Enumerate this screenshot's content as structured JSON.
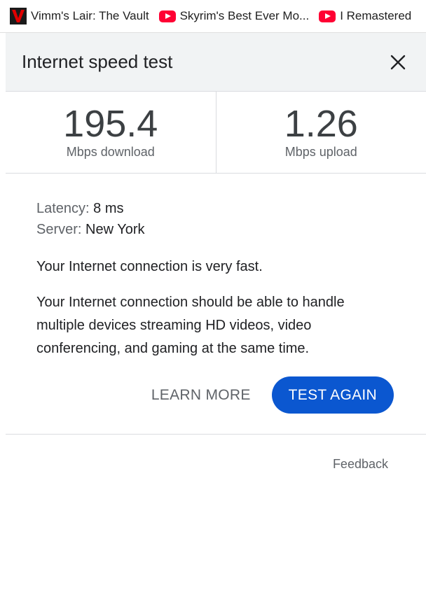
{
  "bookmarks": [
    {
      "label": "Vimm's Lair: The Vault",
      "icon": "vimm-logo-icon"
    },
    {
      "label": "Skyrim's Best Ever Mo...",
      "icon": "youtube-icon"
    },
    {
      "label": "I Remastered",
      "icon": "youtube-icon"
    }
  ],
  "panel": {
    "title": "Internet speed test",
    "close_icon": "close-icon"
  },
  "metrics": {
    "download": {
      "value": "195.4",
      "unit": "Mbps download"
    },
    "upload": {
      "value": "1.26",
      "unit": "Mbps upload"
    }
  },
  "details": {
    "latency_label": "Latency:",
    "latency_value": "8 ms",
    "server_label": "Server:",
    "server_value": "New York"
  },
  "message": {
    "headline": "Your Internet connection is very fast.",
    "description": "Your Internet connection should be able to handle multiple devices streaming HD videos, video conferencing, and gaming at the same time."
  },
  "actions": {
    "learn_more": "LEARN MORE",
    "test_again": "TEST AGAIN"
  },
  "feedback": "Feedback",
  "colors": {
    "accent": "#0b57d0",
    "header_bg": "#f1f3f4",
    "youtube": "#ff0033"
  }
}
